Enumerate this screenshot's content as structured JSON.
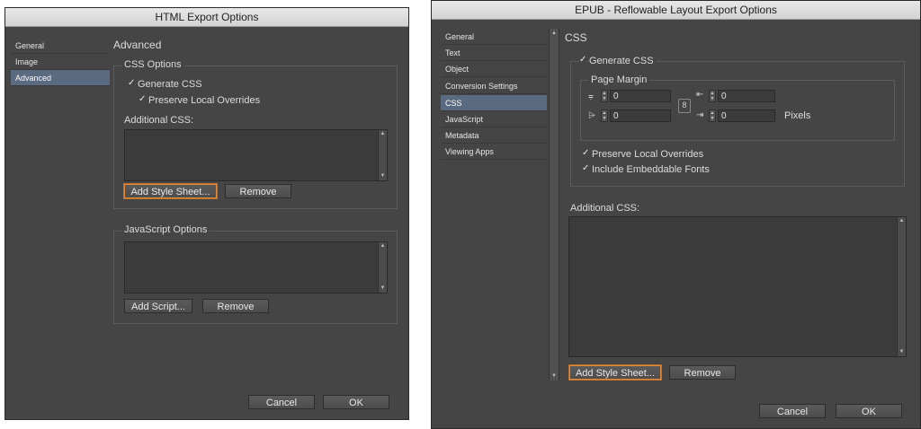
{
  "left": {
    "title": "HTML Export Options",
    "nav": [
      "General",
      "Image",
      "Advanced"
    ],
    "section": "Advanced",
    "css_group": "CSS Options",
    "generate_css": "Generate CSS",
    "preserve_overrides": "Preserve Local Overrides",
    "additional_css": "Additional CSS:",
    "add_style_sheet": "Add Style Sheet...",
    "remove": "Remove",
    "js_group": "JavaScript Options",
    "add_script": "Add Script...",
    "remove2": "Remove",
    "cancel": "Cancel",
    "ok": "OK"
  },
  "right": {
    "title": "EPUB - Reflowable Layout Export Options",
    "nav": [
      "General",
      "Text",
      "Object",
      "Conversion Settings",
      "CSS",
      "JavaScript",
      "Metadata",
      "Viewing Apps"
    ],
    "section": "CSS",
    "generate_css": "Generate CSS",
    "page_margin": "Page Margin",
    "margin_top": "0",
    "margin_bottom": "0",
    "margin_left": "0",
    "margin_right": "0",
    "units": "Pixels",
    "preserve_overrides": "Preserve Local Overrides",
    "include_fonts": "Include Embeddable Fonts",
    "additional_css": "Additional CSS:",
    "add_style_sheet": "Add Style Sheet...",
    "remove": "Remove",
    "cancel": "Cancel",
    "ok": "OK"
  }
}
